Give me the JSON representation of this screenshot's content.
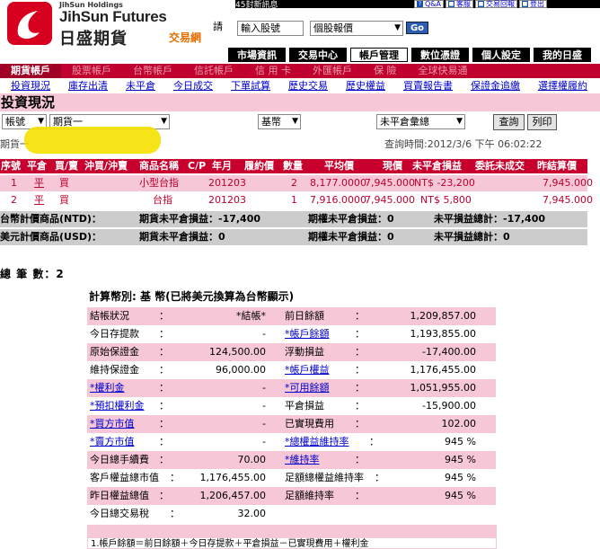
{
  "brand": {
    "holdings": "JihSun Holdings",
    "name_en": "JihSun Futures",
    "name_zh": "日盛期貨",
    "trade_net": "交易網",
    "accent": "#c0002e"
  },
  "top_bar": {
    "text": "45封新訊息",
    "links": [
      "Q&A",
      "客服",
      "交易回報",
      "登出"
    ]
  },
  "quote": {
    "label": "請",
    "input_value": "輸入股號",
    "select_value": "個股報價",
    "go_label": "Go"
  },
  "main_nav": [
    "市場資訊",
    "交易中心",
    "帳戶管理",
    "數位憑證",
    "個人設定",
    "我的日盛"
  ],
  "main_nav_active": 2,
  "sub_nav": [
    "期貨帳戶",
    "股票帳戶",
    "台幣帳戶",
    "信託帳戶",
    "信 用 卡",
    "外匯帳戶",
    "保 險",
    "全球快易通"
  ],
  "sub_nav2": [
    "投資現況",
    "庫存出清",
    "未平倉",
    "今日成交",
    "下單試算",
    "歷史交易",
    "歷史權益",
    "買賣報告書",
    "保證金追繳",
    "選擇權履約"
  ],
  "page_title": "投資現況",
  "filters": {
    "account_type": "帳號",
    "account": "期貨一",
    "currency": "基幣",
    "view": "未平倉彙總",
    "query_button": "查詢",
    "print_button": "列印"
  },
  "account_label": "期貨一",
  "query_time": "查詢時間:2012/3/6 下午 06:02:22",
  "positions": {
    "headers": [
      "序號",
      "平倉",
      "買/賣",
      "沖買/沖賣",
      "商品名稱",
      "C/P",
      "年月",
      "履約價",
      "數量",
      "平均價",
      "現價",
      "未平倉損益",
      "委託未成交",
      "昨結算價"
    ],
    "rows": [
      {
        "no": "1",
        "close": "平",
        "side": "買",
        "name": "小型台指",
        "cp": "",
        "ym": "201203",
        "strike": "",
        "qty": "2",
        "avg": "8,177.0000",
        "price": "7,945.000",
        "pnl": "NT$ -23,200",
        "pending": "",
        "settle": "7,945.000"
      },
      {
        "no": "2",
        "close": "平",
        "side": "買",
        "name": "台指",
        "cp": "",
        "ym": "201203",
        "strike": "",
        "qty": "1",
        "avg": "7,916.0000",
        "price": "7,945.000",
        "pnl": "NT$ 5,800",
        "pending": "",
        "settle": "7,945.000"
      }
    ]
  },
  "summary": [
    {
      "label": "台幣計價商品(NTD)：",
      "fut": "期貨未平倉損益：-17,400",
      "opt": "期權未平倉損益：0",
      "total": "未平損益總計：-17,400"
    },
    {
      "label": "美元計價商品(USD)：",
      "fut": "期貨未平倉損益：0",
      "opt": "期權未平倉損益：0",
      "total": "未平損益總計：0"
    }
  ],
  "total_count": "總 筆 數：2",
  "calc_title": "計算幣別: 基 幣(已將美元換算為台幣顯示)",
  "calc_rows": [
    {
      "l1": "結帳狀況",
      "v1": "*結帳*",
      "l2": "前日餘額",
      "v2": "1,209,857.00",
      "link1": false,
      "link2": false
    },
    {
      "l1": "今日存提款",
      "v1": "-",
      "l2": "*帳戶餘額",
      "v2": "1,193,855.00",
      "link1": false,
      "link2": true
    },
    {
      "l1": "原始保證金",
      "v1": "124,500.00",
      "l2": "浮動損益",
      "v2": "-17,400.00",
      "link1": false,
      "link2": false
    },
    {
      "l1": "維持保證金",
      "v1": "96,000.00",
      "l2": "*帳戶權益",
      "v2": "1,176,455.00",
      "link1": false,
      "link2": true
    },
    {
      "l1": "*權利金",
      "v1": "-",
      "l2": "*可用餘額",
      "v2": "1,051,955.00",
      "link1": true,
      "link2": true
    },
    {
      "l1": "*預扣權利金",
      "v1": "-",
      "l2": "平倉損益",
      "v2": "-15,900.00",
      "link1": true,
      "link2": false
    },
    {
      "l1": "*買方市值",
      "v1": "-",
      "l2": "已實現費用",
      "v2": "102.00",
      "link1": true,
      "link2": false
    },
    {
      "l1": "*賣方市值",
      "v1": "-",
      "l2": "*總權益維持率",
      "v2": "945 %",
      "link1": true,
      "link2": true
    },
    {
      "l1": "今日總手續費",
      "v1": "70.00",
      "l2": "*維持率",
      "v2": "945 %",
      "link1": false,
      "link2": true
    },
    {
      "l1": "客戶權益總市值",
      "v1": "1,176,455.00",
      "l2": "足額總權益維持率",
      "v2": "945 %",
      "link1": false,
      "link2": false
    },
    {
      "l1": "昨日權益總值",
      "v1": "1,206,457.00",
      "l2": "足額維持率",
      "v2": "945 %",
      "link1": false,
      "link2": false
    },
    {
      "l1": "今日總交易稅",
      "v1": "32.00",
      "l2": "",
      "v2": "",
      "link1": false,
      "link2": false
    }
  ],
  "note": "1.帳戶餘額＝前日餘額＋今日存提款＋平倉損益－已實現費用＋權利金"
}
